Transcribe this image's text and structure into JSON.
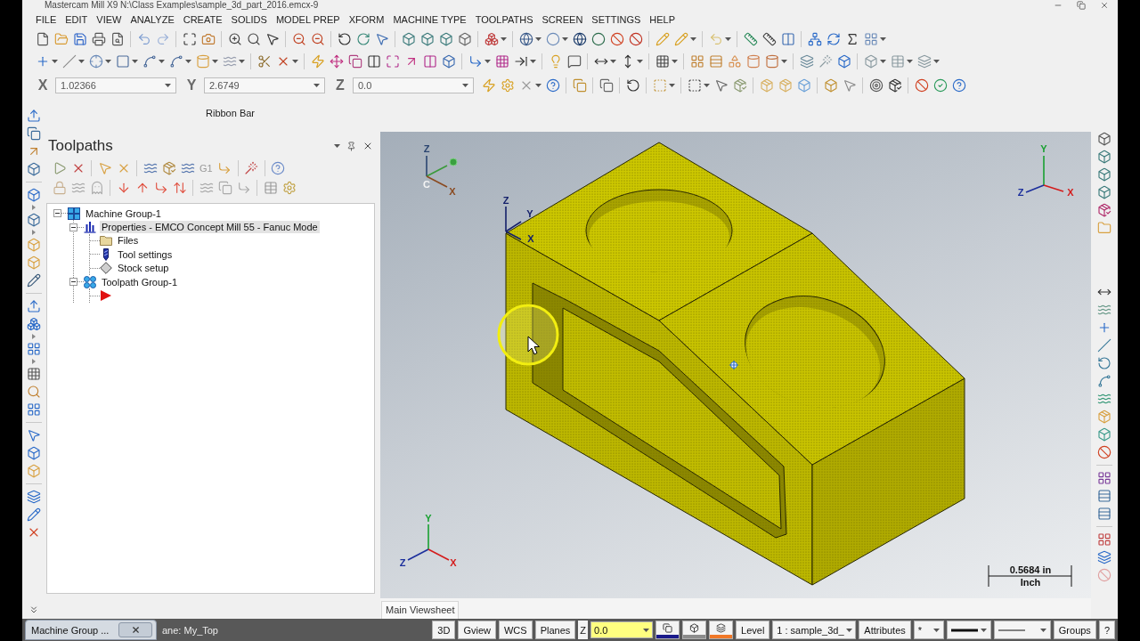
{
  "window": {
    "title": "Mastercam Mill X9 N:\\Class Examples\\sample_3d_part_2016.emcx-9"
  },
  "menu": [
    "FILE",
    "EDIT",
    "VIEW",
    "ANALYZE",
    "CREATE",
    "SOLIDS",
    "MODEL PREP",
    "XFORM",
    "MACHINE TYPE",
    "TOOLPATHS",
    "SCREEN",
    "SETTINGS",
    "HELP"
  ],
  "coordinates": [
    {
      "label": "X",
      "value": "1.02366"
    },
    {
      "label": "Y",
      "value": "2.6749"
    },
    {
      "label": "Z",
      "value": "0.0"
    }
  ],
  "ribbon_bar": {
    "label": "Ribbon Bar"
  },
  "toolpaths_panel": {
    "title": "Toolpaths",
    "toolbar_label": "G1",
    "tree": [
      {
        "label": "Machine Group-1",
        "kind": "machine-group",
        "expanded": true,
        "selected": false,
        "children": [
          {
            "label": "Properties - EMCO Concept Mill 55 - Fanuc Mode",
            "kind": "properties",
            "expanded": true,
            "selected": true,
            "children": [
              {
                "label": "Files",
                "kind": "folder",
                "selected": false
              },
              {
                "label": "Tool settings",
                "kind": "tool",
                "selected": false
              },
              {
                "label": "Stock setup",
                "kind": "stock",
                "selected": false
              }
            ]
          },
          {
            "label": "Toolpath Group-1",
            "kind": "toolpath-group",
            "expanded": true,
            "selected": false
          }
        ]
      }
    ]
  },
  "viewport": {
    "triads": [
      {
        "labels": [
          "Z",
          "C",
          "X"
        ]
      },
      {
        "labels": [
          "Z",
          "Y",
          "X"
        ]
      },
      {
        "labels": [
          "Y",
          "Z",
          "X"
        ]
      },
      {
        "labels": [
          "Y",
          "Z",
          "X"
        ]
      }
    ],
    "scale": {
      "value": "0.5684 in",
      "unit": "Inch"
    },
    "sheet_tab": "Main Viewsheet"
  },
  "docked_tab": {
    "label": "Machine Group ..."
  },
  "status_bar": {
    "plane_text": "ane: My_Top",
    "view_buttons": [
      "3D",
      "Gview",
      "WCS",
      "Planes"
    ],
    "z_label": "Z",
    "z_value": "0.0",
    "color_buttons": [
      {
        "color": "#1a1a8a"
      },
      {
        "color": "#8c8c8c"
      },
      {
        "color": "#f07828"
      }
    ],
    "level_button": "Level",
    "level_value": "1 : sample_3d_",
    "attributes_button": "Attributes",
    "point_style": "*",
    "groups_button": "Groups",
    "help_button": "?"
  }
}
